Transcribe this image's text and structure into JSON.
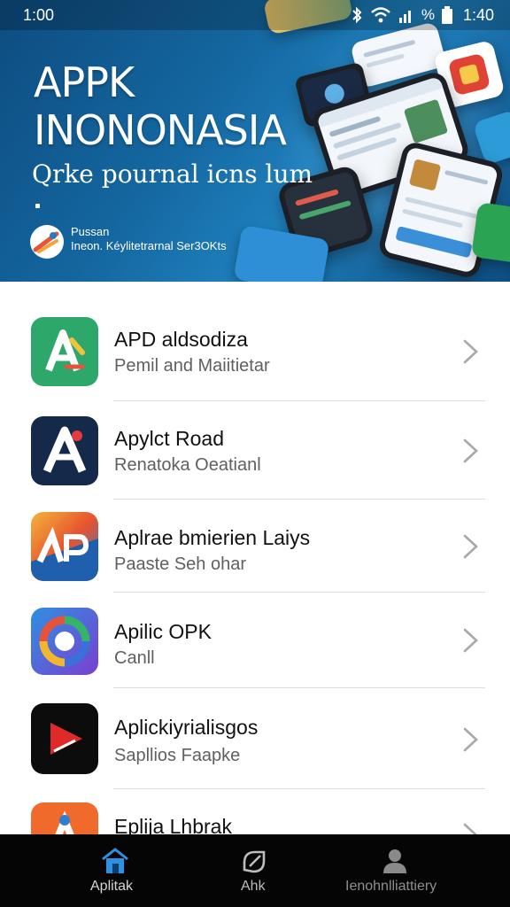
{
  "status_bar": {
    "time_left": "1:00",
    "battery_percent": "%",
    "time_right": "1:40"
  },
  "hero": {
    "title_line1": "APPK",
    "title_line2": "INONONASIA",
    "subtitle": "Qrke pournal icns lum",
    "caption_line1": "Pussan",
    "caption_line2": "Ineon. Kéylitetrarnal Ser3OKts"
  },
  "apps": [
    {
      "title": "APD aldsodiza",
      "subtitle": "Pemil and Maiitietar",
      "icon": "app-green-a-icon"
    },
    {
      "title": "Apylct Road",
      "subtitle": "Renatoka Oeatianl",
      "icon": "app-navy-a-icon"
    },
    {
      "title": "Aplrae bmierien Laiys",
      "subtitle": "Paaste Seh ohar",
      "icon": "app-ap-icon"
    },
    {
      "title": "Apilic OPK",
      "subtitle": "Canll",
      "icon": "app-swirl-icon"
    },
    {
      "title": "Aplickiyrialisgos",
      "subtitle": "Sapllios Faapke",
      "icon": "app-play-icon"
    },
    {
      "title": "Eplija Lhbrak",
      "subtitle": "",
      "icon": "app-orange-icon"
    }
  ],
  "bottom_nav": [
    {
      "label": "Aplitak",
      "icon": "home-icon"
    },
    {
      "label": "Ahk",
      "icon": "apk-icon"
    },
    {
      "label": "Ienohnlliattiery",
      "icon": "profile-icon"
    }
  ]
}
